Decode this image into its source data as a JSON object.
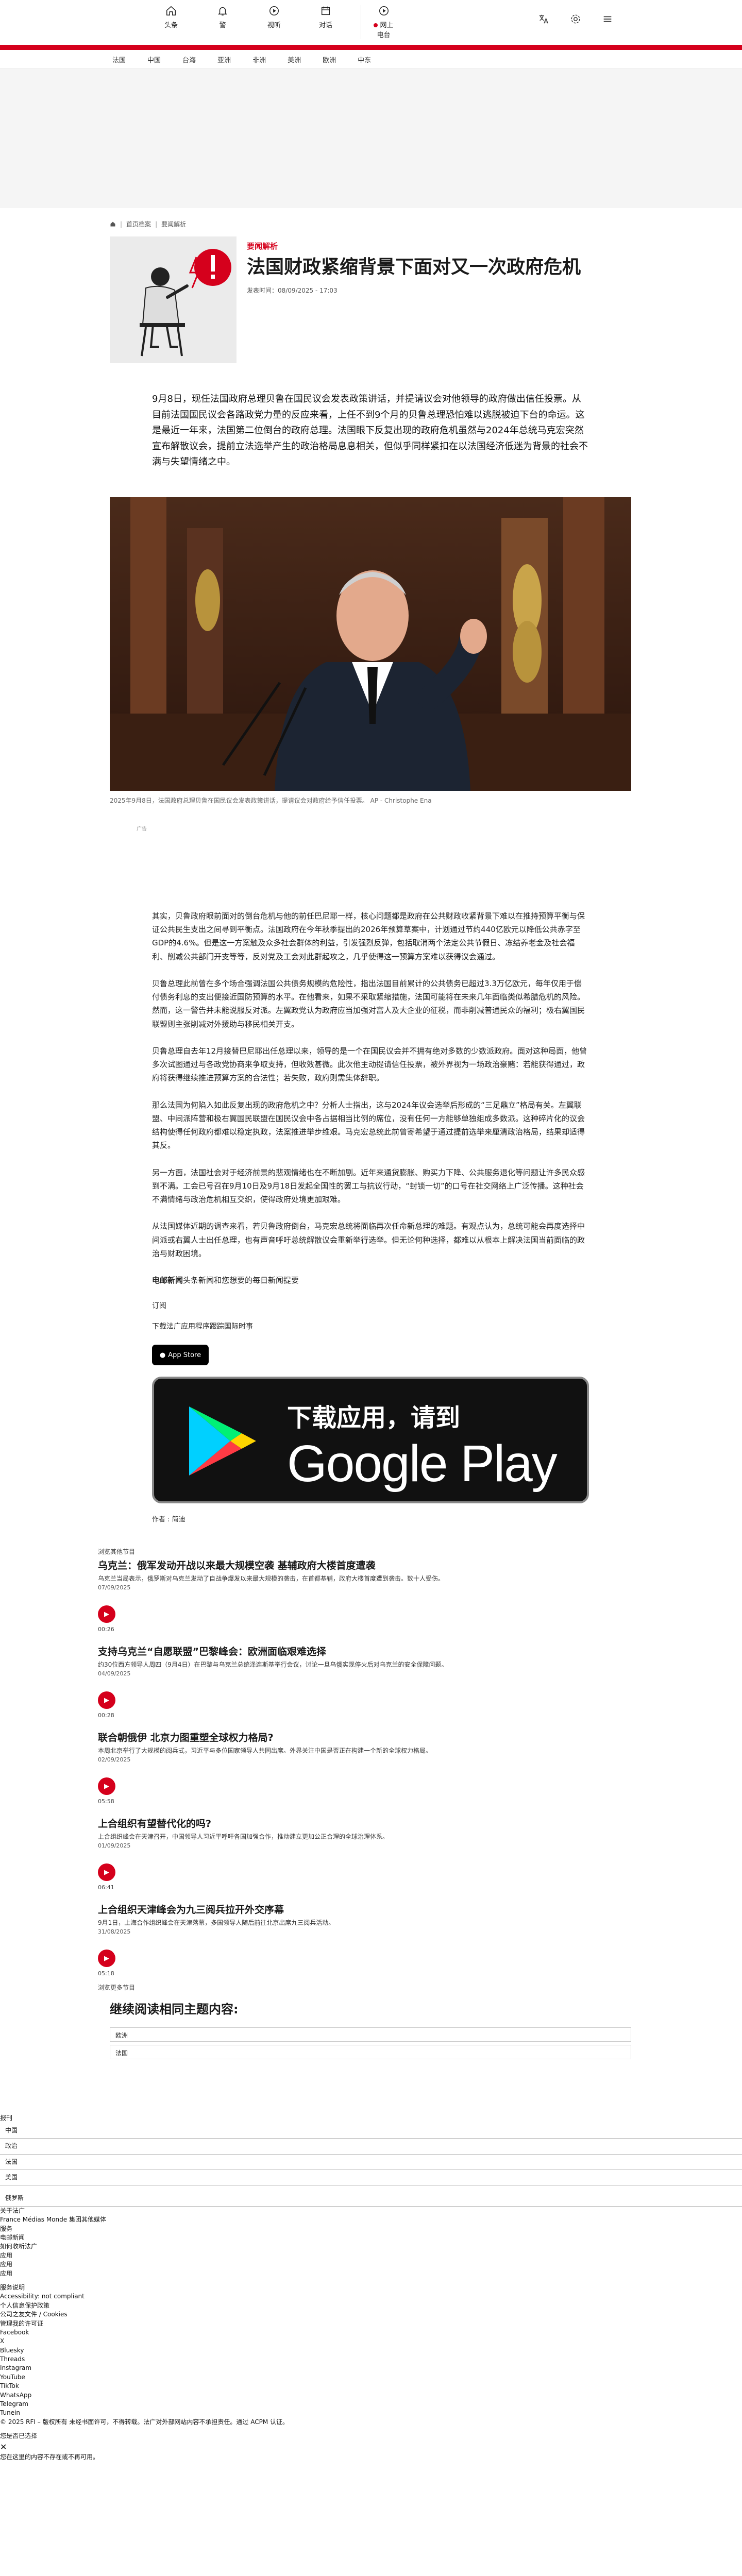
{
  "header": {
    "nav": [
      {
        "label": "头条",
        "icon": "home-icon"
      },
      {
        "label": "警",
        "icon": "bell-icon"
      },
      {
        "label": "视听",
        "icon": "play-circle-icon"
      },
      {
        "label": "对话",
        "icon": "calendar-icon"
      }
    ],
    "live_label": "网上 电台",
    "right_icons": [
      "translate-icon",
      "settings-icon",
      "menu-icon"
    ],
    "brand_red": "#d5001c"
  },
  "sections": [
    "法国",
    "中国",
    "台海",
    "亚洲",
    "非洲",
    "美洲",
    "欧洲",
    "中东"
  ],
  "breadcrumb": {
    "items": [
      "首页档案",
      "要闻解析"
    ]
  },
  "article": {
    "kicker": "要闻解析",
    "title": "法国财政紧缩背景下面对又一次政府危机",
    "date": "发表时间：08/09/2025 - 17:03",
    "lead": "9月8日，现任法国政府总理贝鲁在国民议会发表政策讲话，并提请议会对他领导的政府做出信任投票。从目前法国国民议会各路政党力量的反应来看，上任不到9个月的贝鲁总理恐怕难以逃脱被迫下台的命运。这是最近一年来，法国第二位倒台的政府总理。法国眼下反复出现的政府危机虽然与2024年总统马克宏突然宣布解散议会，提前立法选举产生的政治格局息息相关，但似乎同样紧扣在以法国经济低迷为背景的社会不满与失望情绪之中。",
    "photo_caption": "2025年9月8日，法国政府总理贝鲁在国民议会发表政策讲话，提请议会对政府给予信任投票。 AP - Christophe Ena",
    "ad_label": "广告",
    "paragraphs": [
      "其实，贝鲁政府眼前面对的倒台危机与他的前任巴尼耶一样，核心问题都是政府在公共财政收紧背景下难以在推持预算平衡与保证公共民生支出之间寻到平衡点。法国政府在今年秋季提出的2026年预算草案中，计划通过节约440亿欧元以降低公共赤字至GDP的4.6%。但是这一方案触及众多社会群体的利益，引发强烈反弹，包括取消两个法定公共节假日、冻结养老金及社会福利、削减公共部门开支等等，反对党及工会对此群起攻之，几乎使得这一预算方案难以获得议会通过。",
      "贝鲁总理此前曾在多个场合强调法国公共债务规模的危险性，指出法国目前累计的公共债务已超过3.3万亿欧元，每年仅用于偿付债务利息的支出便接近国防预算的水平。在他看来，如果不采取紧缩措施，法国可能将在未来几年面临类似希腊危机的风险。然而，这一警告并未能说服反对派。左翼政党认为政府应当加强对富人及大企业的征税，而非削减普通民众的福利；极右翼国民联盟则主张削减对外援助与移民相关开支。",
      "贝鲁总理自去年12月接替巴尼耶出任总理以来，领导的是一个在国民议会并不拥有绝对多数的少数派政府。面对这种局面，他曾多次试图通过与各政党协商来争取支持，但收效甚微。此次他主动提请信任投票，被外界视为一场政治豪赌：若能获得通过，政府将获得继续推进预算方案的合法性；若失败，政府则需集体辞职。",
      "那么法国为何陷入如此反复出现的政府危机之中？分析人士指出，这与2024年议会选举后形成的“三足鼎立”格局有关。左翼联盟、中间派阵营和极右翼国民联盟在国民议会中各占据相当比例的席位，没有任何一方能够单独组成多数派。这种碎片化的议会结构使得任何政府都难以稳定执政，法案推进举步维艰。马克宏总统此前曾寄希望于通过提前选举来厘清政治格局，结果却适得其反。",
      "另一方面，法国社会对于经济前景的悲观情绪也在不断加剧。近年来通货膨胀、购买力下降、公共服务退化等问题让许多民众感到不满。工会已号召在9月10日及9月18日发起全国性的罢工与抗议行动，“封锁一切”的口号在社交网络上广泛传播。这种社会不满情绪与政治危机相互交织，使得政府处境更加艰难。",
      "从法国媒体近期的调查来看，若贝鲁政府倒台，马克宏总统将面临再次任命新总理的难题。有观点认为，总统可能会再度选择中间派或右翼人士出任总理，也有声音呼吁总统解散议会重新举行选举。但无论何种选择，都难以从根本上解决法国当前面临的政治与财政困境。"
    ],
    "source_label": "电邮新闻",
    "source_text": "头条新闻和您想要的每日新闻提要",
    "subscribe_label": "订阅",
    "app_prompt": "下载法广应用程序跟踪国际时事",
    "appstore_label": "App Store",
    "googleplay_line1": "下载应用，请到",
    "googleplay_line2": "Google Play",
    "author": "作者 : 简迪"
  },
  "related": {
    "heading": "浏览其他节目",
    "items": [
      {
        "title": "乌克兰：俄军发动开战以来最大规模空袭 基辅政府大楼首度遭袭",
        "desc": "乌克兰当局表示，俄罗斯对乌克兰发动了自战争爆发以来最大规模的袭击，在首都基辅，政府大楼首度遭到袭击。数十人受伤。",
        "date": "07/09/2025",
        "dur": "00:26"
      },
      {
        "title": "支持乌克兰“自愿联盟”巴黎峰会：欧洲面临艰难选择",
        "desc": "约30位西方领导人周四（9月4日）在巴黎与乌克兰总统泽连斯基举行会议，讨论一旦乌俄实现停火后对乌克兰的安全保障问题。",
        "date": "04/09/2025",
        "dur": "00:28"
      },
      {
        "title": "联合朝俄伊 北京力图重塑全球权力格局?",
        "desc": "本周北京举行了大规模的阅兵式，习近平与多位国家领导人共同出席。外界关注中国是否正在构建一个新的全球权力格局。",
        "date": "02/09/2025",
        "dur": "05:58"
      },
      {
        "title": "上合组织有望替代化的吗?",
        "desc": "上合组织峰会在天津召开，中国领导人习近平呼吁各国加强合作，推动建立更加公正合理的全球治理体系。",
        "date": "01/09/2025",
        "dur": "06:41"
      },
      {
        "title": "上合组织天津峰会为九三阅兵拉开外交序幕",
        "desc": "9月1日，上海合作组织峰会在天津落幕，多国领导人随后前往北京出席九三阅兵活动。",
        "date": "31/08/2025",
        "dur": "05:18"
      }
    ],
    "more_label": "浏览更多节目"
  },
  "continue_reading": {
    "heading": "继续阅读相同主题内容:",
    "tags": [
      "欧洲",
      "法国"
    ]
  },
  "footer": {
    "lines": [
      "报刊",
      "中国",
      "政治",
      "法国",
      "美国",
      "俄罗斯",
      "关于法广",
      "France Médias Monde 集团其他媒体",
      "服务",
      "电邮新闻",
      "如何收听法广",
      "应用",
      "应用",
      "应用",
      "服务说明",
      "Accessibility: not compliant",
      "个人信息保护政策",
      "公司之友文件 / Cookies",
      "管理我的许可证",
      "Facebook",
      "X",
      "Bluesky",
      "Threads",
      "Instagram",
      "YouTube",
      "TikTok",
      "WhatsApp",
      "Telegram",
      "Tunein",
      "© 2025 RFI – 版权所有 未经书面许可，不得转载。法广对外部网站内容不承担责任。通过 ACPM 认证。",
      "您是否已选择",
      "您在这里的内容不存在或不再可用。"
    ]
  }
}
